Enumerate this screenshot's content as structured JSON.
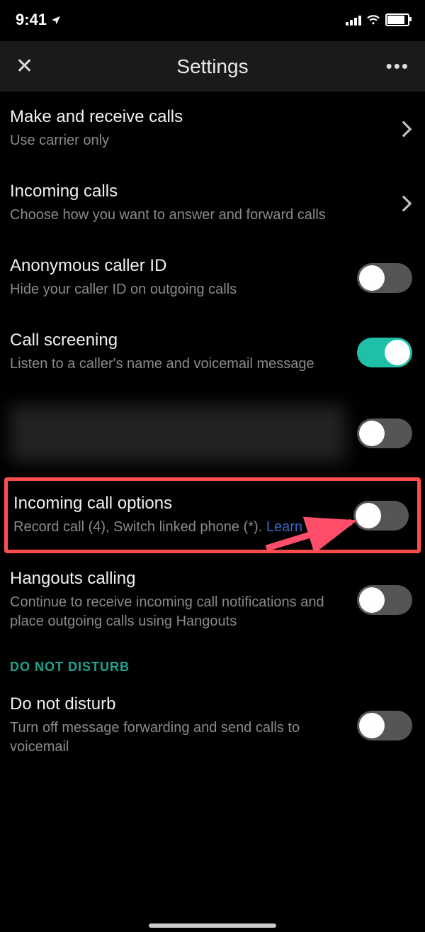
{
  "status": {
    "time": "9:41"
  },
  "header": {
    "title": "Settings"
  },
  "rows": {
    "make_calls": {
      "title": "Make and receive calls",
      "sub": "Use carrier only"
    },
    "incoming": {
      "title": "Incoming calls",
      "sub": "Choose how you want to answer and forward calls"
    },
    "anon": {
      "title": "Anonymous caller ID",
      "sub": "Hide your caller ID on outgoing calls",
      "on": false
    },
    "screening": {
      "title": "Call screening",
      "sub": "Listen to a caller's name and voicemail message",
      "on": true
    },
    "redacted": {
      "on": false
    },
    "options": {
      "title": "Incoming call options",
      "sub": "Record call (4), Switch linked phone (*). ",
      "link": "Learn more",
      "on": false
    },
    "hangouts": {
      "title": "Hangouts calling",
      "sub": "Continue to receive incoming call notifications and place outgoing calls using Hangouts",
      "on": false
    },
    "dnd_section": "DO NOT DISTURB",
    "dnd": {
      "title": "Do not disturb",
      "sub": "Turn off message forwarding and send calls to voicemail",
      "on": false
    }
  }
}
